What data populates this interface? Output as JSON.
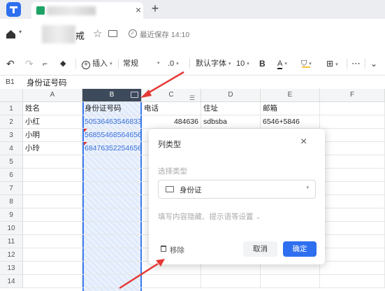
{
  "tabbar": {
    "close": "×",
    "add": "+"
  },
  "titlebar": {
    "doc_title_suffix": "戒",
    "save_status": "最近保存 14:10",
    "star": "☆"
  },
  "toolbar": {
    "insert_label": "插入",
    "format_label": "常规",
    "decimal_label": ".0",
    "font_label": "默认字体",
    "font_size": "10",
    "bold": "B",
    "font_color": "A",
    "more": "⋯"
  },
  "formula_bar": {
    "cell_ref": "B1",
    "content": "身份证号码"
  },
  "columns": [
    "A",
    "B",
    "C",
    "D",
    "E",
    "F"
  ],
  "rows": [
    "1",
    "2",
    "3",
    "4",
    "5",
    "6",
    "7",
    "8",
    "9",
    "10",
    "11",
    "12",
    "13",
    "14"
  ],
  "table": {
    "r1": [
      "姓名",
      "身份证号码",
      "电话",
      "住址",
      "邮箱"
    ],
    "r2": [
      "小红",
      "50536463546833",
      "484636",
      "sdbsba",
      "6546+5846"
    ],
    "r3": [
      "小明",
      "56855468564656",
      "",
      "",
      ""
    ],
    "r4": [
      "小玲",
      "68476352254656",
      "",
      "",
      ""
    ]
  },
  "dialog": {
    "title": "列类型",
    "close": "×",
    "select_label": "选择类型",
    "selected_type": "身份证",
    "advanced": "填写内容隐藏、提示语等设置",
    "remove": "移除",
    "cancel": "取消",
    "confirm": "确定"
  },
  "colors": {
    "accent": "#2e6ff0",
    "selected_header": "#3d4a5c",
    "annotation_arrow": "#e53935"
  }
}
